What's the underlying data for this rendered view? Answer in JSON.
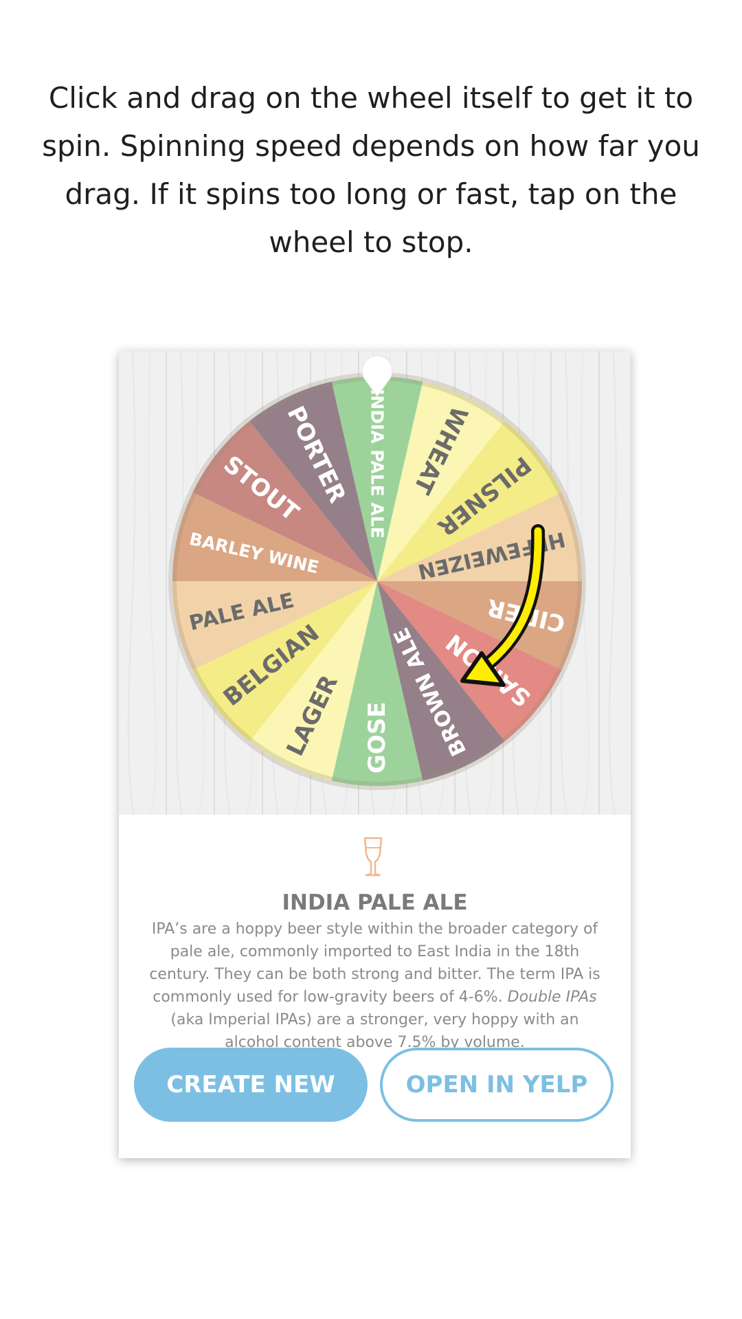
{
  "instructions": "Click and drag on the wheel itself to get it to spin. Spinning speed depends on how far you drag. If it spins too long or fast, tap on the wheel to stop.",
  "wheel": {
    "segments": [
      {
        "label": "INDIA PALE ALE",
        "color": "#9dd39b",
        "text_color": "#ffffff"
      },
      {
        "label": "WHEAT",
        "color": "#fbf6b4",
        "text_color": "#6b6b6b"
      },
      {
        "label": "PILSNER",
        "color": "#f4ec86",
        "text_color": "#6b6b6b"
      },
      {
        "label": "HEFEWEIZEN",
        "color": "#f2d2a9",
        "text_color": "#6b6b6b"
      },
      {
        "label": "CIDER",
        "color": "#dba684",
        "text_color": "#ffffff"
      },
      {
        "label": "SAISON",
        "color": "#e28a83",
        "text_color": "#ffffff"
      },
      {
        "label": "BROWN ALE",
        "color": "#95808a",
        "text_color": "#ffffff"
      },
      {
        "label": "GOSE",
        "color": "#9dd39b",
        "text_color": "#ffffff"
      },
      {
        "label": "LAGER",
        "color": "#fbf6b4",
        "text_color": "#6b6b6b"
      },
      {
        "label": "BELGIAN",
        "color": "#f4ec86",
        "text_color": "#6b6b6b"
      },
      {
        "label": "PALE ALE",
        "color": "#f2d2a9",
        "text_color": "#6b6b6b"
      },
      {
        "label": "BARLEY WINE",
        "color": "#dba684",
        "text_color": "#ffffff"
      },
      {
        "label": "STOUT",
        "color": "#c88882",
        "text_color": "#ffffff"
      },
      {
        "label": "PORTER",
        "color": "#95808a",
        "text_color": "#ffffff"
      }
    ],
    "arrow_color": "#ffee00"
  },
  "selection": {
    "title": "INDIA PALE ALE",
    "desc_part1": "IPA’s are a hoppy beer style within the broader category of pale ale, commonly imported to East India in the 18th century.  They can be both strong and bitter. The term IPA is commonly used for low-gravity beers of 4-6%. ",
    "desc_italic": "Double IPAs",
    "desc_part2": " (aka Imperial IPAs) are a stronger, very hoppy with an alcohol content above 7.5% by volume.",
    "icon": "beer-glass-icon",
    "icon_color": "#f2b690"
  },
  "buttons": {
    "create": "CREATE NEW",
    "yelp": "OPEN IN YELP",
    "color": "#7cbfe3"
  }
}
